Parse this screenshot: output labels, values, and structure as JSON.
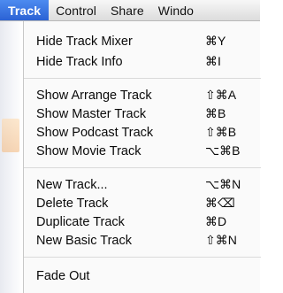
{
  "menubar": {
    "items": [
      {
        "label": "Track"
      },
      {
        "label": "Control"
      },
      {
        "label": "Share"
      },
      {
        "label": "Windo"
      }
    ]
  },
  "menu": {
    "groups": [
      [
        {
          "label": "Hide Track Mixer",
          "shortcut": "⌘Y"
        },
        {
          "label": "Hide Track Info",
          "shortcut": "⌘I"
        }
      ],
      [
        {
          "label": "Show Arrange Track",
          "shortcut": "⇧⌘A"
        },
        {
          "label": "Show Master Track",
          "shortcut": "⌘B"
        },
        {
          "label": "Show Podcast Track",
          "shortcut": "⇧⌘B"
        },
        {
          "label": "Show Movie Track",
          "shortcut": "⌥⌘B"
        }
      ],
      [
        {
          "label": "New Track...",
          "shortcut": "⌥⌘N"
        },
        {
          "label": "Delete Track",
          "shortcut": "⌘⌫"
        },
        {
          "label": "Duplicate Track",
          "shortcut": "⌘D"
        },
        {
          "label": "New Basic Track",
          "shortcut": "⇧⌘N"
        }
      ],
      [
        {
          "label": "Fade Out",
          "shortcut": ""
        }
      ]
    ]
  }
}
